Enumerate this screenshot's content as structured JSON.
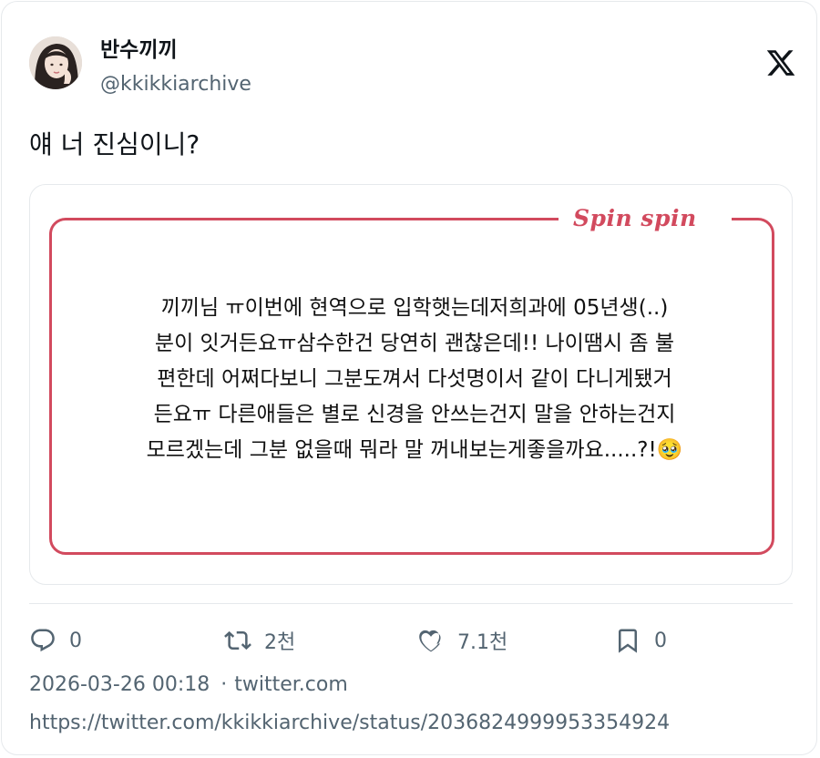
{
  "author": {
    "name": "반수끼끼",
    "handle": "@kkikkiarchive"
  },
  "tweet": {
    "text": "얘 너 진심이니?"
  },
  "media": {
    "brand": "Spin spin",
    "note": "끼끼님  ㅠ이번에 현역으로 입학햇는데저희과에 05년생(..)\n분이 잇거든요ㅠ삼수한건 당연히 괜찮은데!! 나이땜시 좀 불\n편한데 어쩌다보니 그분도껴서 다섯명이서 같이 다니게됐거\n든요ㅠ 다른애들은 별로 신경을 안쓰는건지 말을 안하는건지\n모르겠는데 그분 없을때 뭐라 말 꺼내보는게좋을까요.....?!🥹",
    "frame_color": "#d24a5e"
  },
  "stats": {
    "replies": "0",
    "retweets": "2천",
    "likes": "7.1천",
    "bookmarks": "0"
  },
  "meta": {
    "timestamp": "2026-03-26 00:18",
    "separator": "·",
    "source": "twitter.com",
    "url": "https://twitter.com/kkikkiarchive/status/2036824999953354924"
  },
  "icons": {
    "logo": "x-logo-icon",
    "reply": "reply-icon",
    "retweet": "retweet-icon",
    "like": "heart-icon",
    "bookmark": "bookmark-icon"
  },
  "colors": {
    "text": "#0f1419",
    "muted": "#536471",
    "accent": "#d24a5e",
    "border": "#e6e9ec"
  }
}
